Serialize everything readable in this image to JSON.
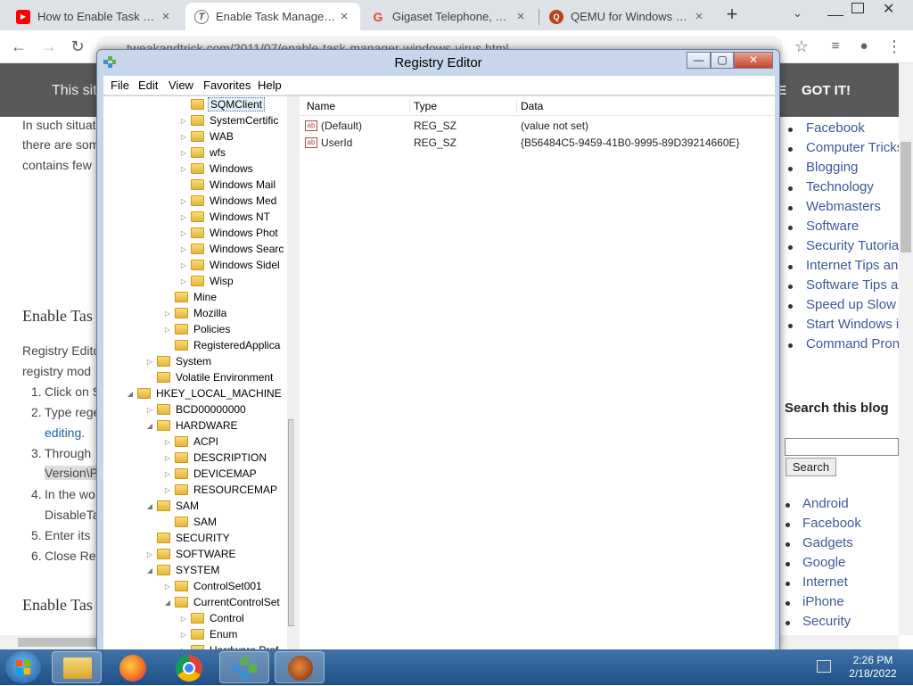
{
  "browser": {
    "tabs": [
      {
        "title": "How to Enable Task Manager",
        "icon": "youtube-icon",
        "active": false
      },
      {
        "title": "Enable Task Manager disabled",
        "icon": "site-icon",
        "active": true
      },
      {
        "title": "Gigaset Telephone, Smart",
        "icon": "google-icon",
        "active": false
      },
      {
        "title": "QEMU for Windows – Ins",
        "icon": "qemu-icon",
        "active": false
      }
    ],
    "url": "tweakandtrick.com/2011/07/enable-task-manager-windows-virus.html",
    "new_tab": "+"
  },
  "page": {
    "site_note": "This site",
    "gotit": "GOT IT!",
    "paragraph1": [
      "In such situat",
      "there are som",
      "contains few"
    ],
    "heading1": "Enable Tas",
    "paragraph2": [
      "Registry Edito",
      "registry mod"
    ],
    "steps": [
      {
        "num": "1.",
        "text": "Click on S"
      },
      {
        "num": "2.",
        "text": "Type rege"
      },
      {
        "num": "",
        "text": "editing."
      },
      {
        "num": "3.",
        "text": "Through"
      },
      {
        "num": "",
        "text": "Version\\P"
      },
      {
        "num": "4.",
        "text": "In the wo"
      },
      {
        "num": "",
        "text": "DisableTa"
      },
      {
        "num": "5.",
        "text": "Enter its"
      },
      {
        "num": "6.",
        "text": "Close Reg"
      }
    ],
    "heading2": "Enable Tas",
    "sidebar_links": [
      "Facebook",
      "Computer Tricks",
      "Blogging",
      "Technology",
      "Webmasters",
      "Software",
      "Security Tutorial",
      "Internet Tips an",
      "Software Tips ar",
      "Speed up Slow",
      "Start Windows i",
      "Command Pron"
    ],
    "search_title": "Search this blog",
    "search_button": "Search",
    "labels": [
      "Android",
      "Facebook",
      "Gadgets",
      "Google",
      "Internet",
      "iPhone",
      "Security"
    ]
  },
  "regedit": {
    "title": "Registry Editor",
    "menu": [
      "File",
      "Edit",
      "View",
      "Favorites",
      "Help"
    ],
    "tree": [
      {
        "label": "SQMClient",
        "level": 5,
        "arrow": "",
        "selected": true
      },
      {
        "label": "SystemCertific",
        "level": 5,
        "arrow": "▷"
      },
      {
        "label": "WAB",
        "level": 5,
        "arrow": "▷"
      },
      {
        "label": "wfs",
        "level": 5,
        "arrow": "▷"
      },
      {
        "label": "Windows",
        "level": 5,
        "arrow": "▷"
      },
      {
        "label": "Windows Mail",
        "level": 5,
        "arrow": ""
      },
      {
        "label": "Windows Med",
        "level": 5,
        "arrow": "▷"
      },
      {
        "label": "Windows NT",
        "level": 5,
        "arrow": "▷"
      },
      {
        "label": "Windows Phot",
        "level": 5,
        "arrow": "▷"
      },
      {
        "label": "Windows Searc",
        "level": 5,
        "arrow": "▷"
      },
      {
        "label": "Windows Sidel",
        "level": 5,
        "arrow": "▷"
      },
      {
        "label": "Wisp",
        "level": 5,
        "arrow": "▷"
      },
      {
        "label": "Mine",
        "level": 4,
        "arrow": ""
      },
      {
        "label": "Mozilla",
        "level": 4,
        "arrow": "▷"
      },
      {
        "label": "Policies",
        "level": 4,
        "arrow": "▷"
      },
      {
        "label": "RegisteredApplica",
        "level": 4,
        "arrow": ""
      },
      {
        "label": "System",
        "level": 3,
        "arrow": "▷"
      },
      {
        "label": "Volatile Environment",
        "level": 3,
        "arrow": ""
      },
      {
        "label": "HKEY_LOCAL_MACHINE",
        "level": 2,
        "arrow": "◢"
      },
      {
        "label": "BCD00000000",
        "level": 3,
        "arrow": "▷"
      },
      {
        "label": "HARDWARE",
        "level": 3,
        "arrow": "◢"
      },
      {
        "label": "ACPI",
        "level": 4,
        "arrow": "▷"
      },
      {
        "label": "DESCRIPTION",
        "level": 4,
        "arrow": "▷"
      },
      {
        "label": "DEVICEMAP",
        "level": 4,
        "arrow": "▷"
      },
      {
        "label": "RESOURCEMAP",
        "level": 4,
        "arrow": "▷"
      },
      {
        "label": "SAM",
        "level": 3,
        "arrow": "◢"
      },
      {
        "label": "SAM",
        "level": 4,
        "arrow": ""
      },
      {
        "label": "SECURITY",
        "level": 3,
        "arrow": ""
      },
      {
        "label": "SOFTWARE",
        "level": 3,
        "arrow": "▷"
      },
      {
        "label": "SYSTEM",
        "level": 3,
        "arrow": "◢"
      },
      {
        "label": "ControlSet001",
        "level": 4,
        "arrow": "▷"
      },
      {
        "label": "CurrentControlSet",
        "level": 4,
        "arrow": "◢"
      },
      {
        "label": "Control",
        "level": 5,
        "arrow": "▷"
      },
      {
        "label": "Enum",
        "level": 5,
        "arrow": "▷"
      },
      {
        "label": "Hardware Prof",
        "level": 5,
        "arrow": "▷"
      }
    ],
    "columns": {
      "name": "Name",
      "type": "Type",
      "data": "Data"
    },
    "values": [
      {
        "name": "(Default)",
        "type": "REG_SZ",
        "data": "(value not set)",
        "icon": "ab"
      },
      {
        "name": "UserId",
        "type": "REG_SZ",
        "data": "{B56484C5-9459-41B0-9995-89D39214660E}",
        "icon": "ab"
      }
    ]
  },
  "taskbar": {
    "time": "2:26 PM",
    "date": "2/18/2022"
  }
}
